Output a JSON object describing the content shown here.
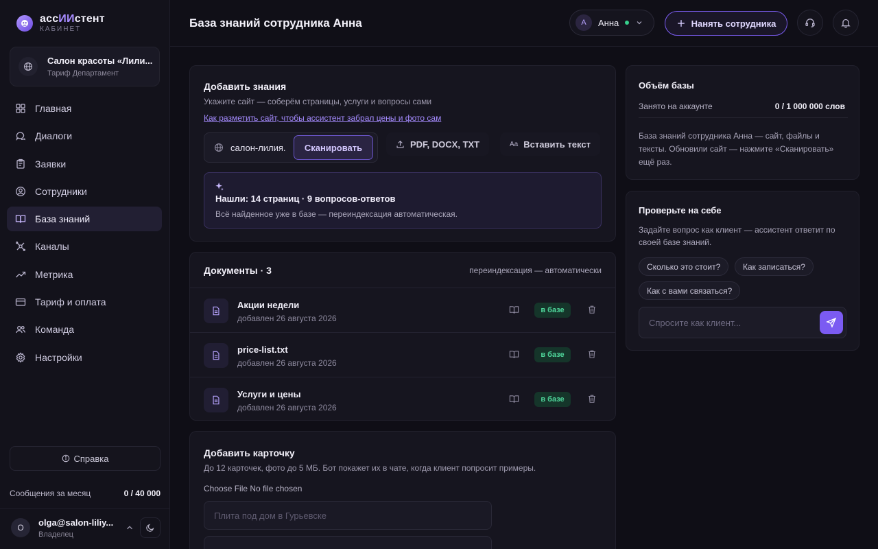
{
  "brand": {
    "title_a": "асс",
    "title_b": "ИИ",
    "title_c": "стент",
    "subtitle": "КАБИНЕТ"
  },
  "org": {
    "name": "Салон красоты «Лили...",
    "plan": "Тариф Департамент"
  },
  "nav": [
    {
      "label": "Главная",
      "icon": "home-grid-icon"
    },
    {
      "label": "Диалоги",
      "icon": "chat-icon"
    },
    {
      "label": "Заявки",
      "icon": "clipboard-icon"
    },
    {
      "label": "Сотрудники",
      "icon": "user-circle-icon"
    },
    {
      "label": "База знаний",
      "icon": "book-icon",
      "active": true
    },
    {
      "label": "Каналы",
      "icon": "satellite-icon"
    },
    {
      "label": "Метрика",
      "icon": "trend-icon"
    },
    {
      "label": "Тариф и оплата",
      "icon": "card-icon"
    },
    {
      "label": "Команда",
      "icon": "users-icon"
    },
    {
      "label": "Настройки",
      "icon": "gear-icon"
    }
  ],
  "help": "Справка",
  "messages": {
    "label": "Сообщения за месяц",
    "value": "0 / 40 000"
  },
  "user": {
    "initial": "O",
    "email": "olga@salon-liliy...",
    "role": "Владелец"
  },
  "header": {
    "title": "База знаний сотрудника Анна",
    "employee": {
      "initial": "А",
      "name": "Анна"
    },
    "hire_label": "Нанять сотрудника"
  },
  "add_knowledge": {
    "title": "Добавить знания",
    "subtitle": "Укажите сайт — соберём страницы, услуги и вопросы сами",
    "link": "Как разметить сайт, чтобы ассистент забрал цены и фото сам",
    "site_value": "салон-лилия.",
    "scan_label": "Сканировать",
    "files_label": "PDF, DOCX, TXT",
    "paste_label": "Вставить текст",
    "found_title": "Нашли: 14 страниц · 9 вопросов-ответов",
    "found_text": "Всё найденное уже в базе — переиндексация автоматическая."
  },
  "documents": {
    "title": "Документы · 3",
    "note": "переиндексация — автоматически",
    "items": [
      {
        "name": "Акции недели",
        "date": "добавлен 26 августа 2026",
        "status": "в базе"
      },
      {
        "name": "price-list.txt",
        "date": "добавлен 26 августа 2026",
        "status": "в базе"
      },
      {
        "name": "Услуги и цены",
        "date": "добавлен 26 августа 2026",
        "status": "в базе"
      }
    ]
  },
  "add_card": {
    "title": "Добавить карточку",
    "subtitle": "До 12 карточек, фото до 5 МБ. Бот покажет их в чате, когда клиент попросит примеры.",
    "file_button": "Choose File",
    "file_status": "No file chosen",
    "title_placeholder": "Плита под дом в Гурьевске"
  },
  "volume": {
    "title": "Объём базы",
    "label": "Занято на аккаунте",
    "value": "0 / 1 000 000 слов",
    "text": "База знаний сотрудника Анна — сайт, файлы и тексты. Обновили сайт — нажмите «Сканировать» ещё раз."
  },
  "test": {
    "title": "Проверьте на себе",
    "text": "Задайте вопрос как клиент — ассистент ответит по своей базе знаний.",
    "chips": [
      "Сколько это стоит?",
      "Как записаться?",
      "Как с вами связаться?"
    ],
    "placeholder": "Спросите как клиент..."
  },
  "colors": {
    "accent": "#7b5bf2",
    "success": "#4fd69b",
    "background": "#0f0e16"
  }
}
